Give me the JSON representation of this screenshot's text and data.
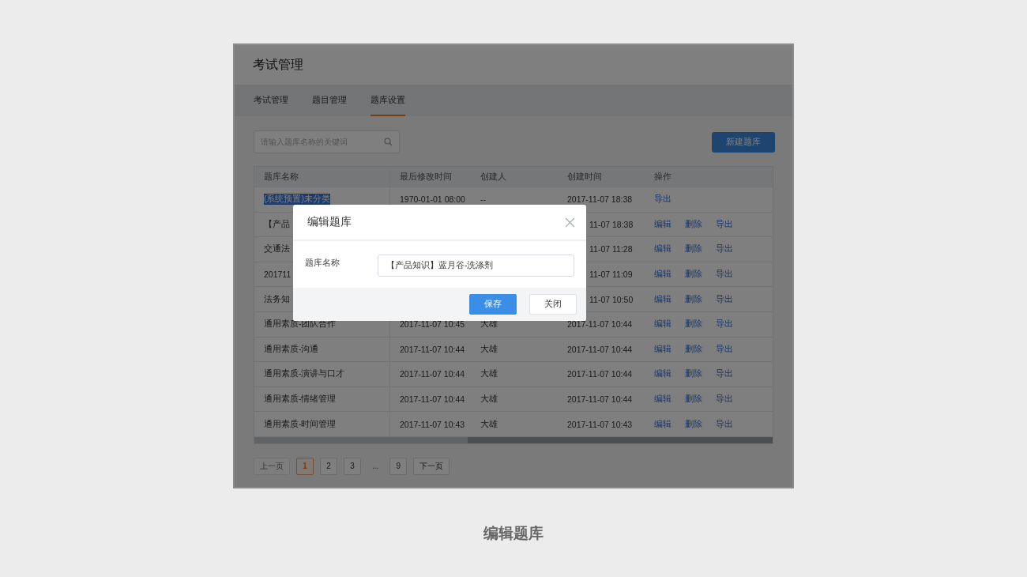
{
  "page": {
    "title": "考试管理",
    "tabs": [
      {
        "label": "考试管理",
        "selected": false
      },
      {
        "label": "题目管理",
        "selected": false
      },
      {
        "label": "题库设置",
        "selected": true
      }
    ]
  },
  "search": {
    "placeholder": "请输入题库名称的关键词"
  },
  "new_button": "新建题库",
  "table": {
    "columns": [
      "题库名称",
      "最后修改时间",
      "创建人",
      "创建时间",
      "操作"
    ],
    "rows": [
      {
        "name": "(系统预置)未分类",
        "highlighted": true,
        "modified": "1970-01-01 08:00",
        "creator": "--",
        "created": "2017-11-07 18:38",
        "actions": [
          "导出"
        ]
      },
      {
        "name": "【产品",
        "highlighted": false,
        "created": "11-07 18:38",
        "actions": [
          "编辑",
          "删除",
          "导出"
        ]
      },
      {
        "name": "交通法",
        "highlighted": false,
        "created": "11-07 11:28",
        "actions": [
          "编辑",
          "删除",
          "导出"
        ]
      },
      {
        "name": "201711",
        "highlighted": false,
        "created": "11-07 11:09",
        "actions": [
          "编辑",
          "删除",
          "导出"
        ]
      },
      {
        "name": "法务知",
        "highlighted": false,
        "created": "11-07 10:50",
        "actions": [
          "编辑",
          "删除",
          "导出"
        ]
      },
      {
        "name": "通用素质-团队合作",
        "highlighted": false,
        "modified": "2017-11-07 10:45",
        "creator": "大雄",
        "created": "2017-11-07 10:44",
        "actions": [
          "编辑",
          "删除",
          "导出"
        ]
      },
      {
        "name": "通用素质-沟通",
        "highlighted": false,
        "modified": "2017-11-07 10:44",
        "creator": "大雄",
        "created": "2017-11-07 10:44",
        "actions": [
          "编辑",
          "删除",
          "导出"
        ]
      },
      {
        "name": "通用素质-演讲与口才",
        "highlighted": false,
        "modified": "2017-11-07 10:44",
        "creator": "大雄",
        "created": "2017-11-07 10:44",
        "actions": [
          "编辑",
          "删除",
          "导出"
        ]
      },
      {
        "name": "通用素质-情绪管理",
        "highlighted": false,
        "modified": "2017-11-07 10:44",
        "creator": "大雄",
        "created": "2017-11-07 10:44",
        "actions": [
          "编辑",
          "删除",
          "导出"
        ]
      },
      {
        "name": "通用素质-时间管理",
        "highlighted": false,
        "modified": "2017-11-07 10:43",
        "creator": "大雄",
        "created": "2017-11-07 10:43",
        "actions": [
          "编辑",
          "删除",
          "导出"
        ]
      }
    ]
  },
  "pagination": [
    {
      "label": "上一页",
      "kind": "nav",
      "disabled": true,
      "selected": false
    },
    {
      "label": "1",
      "kind": "page",
      "disabled": false,
      "selected": true
    },
    {
      "label": "2",
      "kind": "page",
      "disabled": false,
      "selected": false
    },
    {
      "label": "3",
      "kind": "page",
      "disabled": false,
      "selected": false
    },
    {
      "label": "...",
      "kind": "ellipsis"
    },
    {
      "label": "9",
      "kind": "page",
      "disabled": false,
      "selected": false
    },
    {
      "label": "下一页",
      "kind": "nav",
      "disabled": false,
      "selected": false
    }
  ],
  "dialog": {
    "title": "编辑题库",
    "field_label": "题库名称",
    "field_value": "【产品知识】蓝月谷-洗涤剂",
    "buttons": [
      {
        "label": "保存",
        "kind": "primary"
      },
      {
        "label": "关闭",
        "kind": "default"
      }
    ]
  },
  "caption": "编辑题库"
}
